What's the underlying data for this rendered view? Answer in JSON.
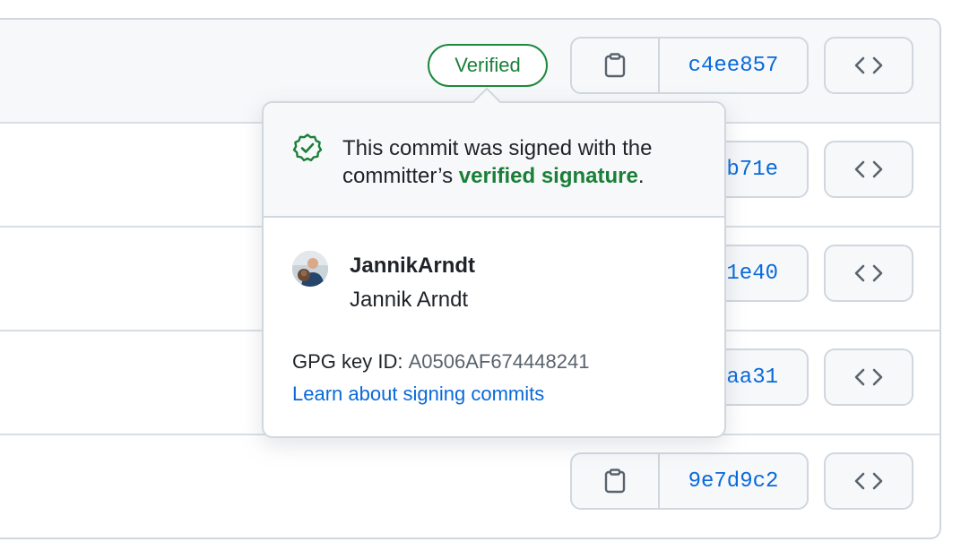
{
  "commits": [
    {
      "sha": "c4ee857",
      "badge": "Verified"
    },
    {
      "sha": "b71e"
    },
    {
      "sha": "1e40"
    },
    {
      "sha": "aa31"
    },
    {
      "sha": "9e7d9c2"
    }
  ],
  "popover": {
    "message_prefix": "This commit was signed with the committer’s ",
    "message_link": "verified signature",
    "message_suffix": ".",
    "login": "JannikArndt",
    "full_name": "Jannik Arndt",
    "gpg_label": "GPG key ID: ",
    "gpg_key": "A0506AF674448241",
    "learn_link": "Learn about signing commits"
  },
  "icons": {
    "copy": "clipboard-icon",
    "browse": "code-icon",
    "verified": "verified-check-icon"
  },
  "colors": {
    "link": "#0969da",
    "verified_green": "#1a7f37",
    "border": "#d0d7de"
  }
}
